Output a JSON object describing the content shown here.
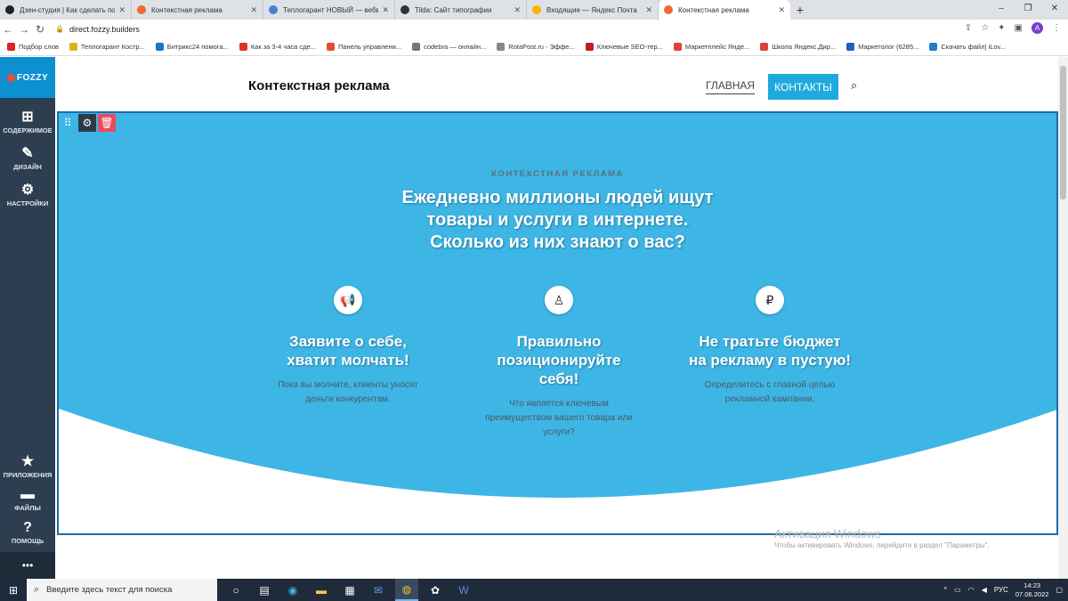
{
  "browser": {
    "tabs": [
      {
        "label": "Дзен-студия | Как сделать посад",
        "color": "#202124"
      },
      {
        "label": "Контекстная реклама",
        "color": "#f06a35"
      },
      {
        "label": "Теплогарант НОВЫЙ — вебвиз",
        "color": "#4a7fd4"
      },
      {
        "label": "Tilda: Сайт типографии",
        "color": "#333333"
      },
      {
        "label": "Входящие — Яндекс Почта",
        "color": "#f7b500"
      },
      {
        "label": "Контекстная реклама",
        "color": "#f06a35",
        "active": true
      }
    ],
    "new_tab": "+",
    "url": "direct.fozzy.builders",
    "profile_letter": "A",
    "bookmarks": [
      {
        "label": "Подбор слов",
        "color": "#d22"
      },
      {
        "label": "Теплогарант Костр...",
        "color": "#e0b020"
      },
      {
        "label": "Битрикс24 помога...",
        "color": "#1e6fd0"
      },
      {
        "label": "Как за 3-4 часа сде...",
        "color": "#e03030"
      },
      {
        "label": "Панель управлени...",
        "color": "#e05030"
      },
      {
        "label": "codebra — онлайн...",
        "color": "#777"
      },
      {
        "label": "RotaPost.ru - Эффе...",
        "color": "#888"
      },
      {
        "label": "Ключевые SEO-тер...",
        "color": "#c02020"
      },
      {
        "label": "Маркетплейс Янде...",
        "color": "#e04040"
      },
      {
        "label": "Школа Яндекс.Дир...",
        "color": "#e04040"
      },
      {
        "label": "Маркетолог (6285...",
        "color": "#2060c0"
      },
      {
        "label": "Скачать файл| iLov...",
        "color": "#2080d0"
      }
    ]
  },
  "sidebar": {
    "logo": "FOZZY",
    "items": [
      {
        "label": "СОДЕРЖИМОЕ",
        "icon": "plus-square-icon",
        "glyph": "⊞"
      },
      {
        "label": "ДИЗАЙН",
        "icon": "brush-icon",
        "glyph": "✎"
      },
      {
        "label": "НАСТРОЙКИ",
        "icon": "gears-icon",
        "glyph": "⚙"
      }
    ],
    "bottom": [
      {
        "label": "ПРИЛОЖЕНИЯ",
        "icon": "star-icon",
        "glyph": "★"
      },
      {
        "label": "ФАЙЛЫ",
        "icon": "folder-icon",
        "glyph": "▬"
      },
      {
        "label": "ПОМОЩЬ",
        "icon": "help-icon",
        "glyph": "?"
      }
    ],
    "more": "•••"
  },
  "site": {
    "title": "Контекстная реклама",
    "nav_home": "ГЛАВНАЯ",
    "nav_contacts": "КОНТАКТЫ",
    "accent": "#1eaadf",
    "block_bg": "#3db6e6"
  },
  "hero": {
    "eyebrow": "КОНТЕКСТНАЯ РЕКЛАМА",
    "headline": [
      "Ежедневно миллионы людей ищут",
      "товары и услуги в интернете.",
      "Сколько из них знают о вас?"
    ],
    "features": [
      {
        "icon": "megaphone-icon",
        "glyph": "📢",
        "title": [
          "Заявите о себе,",
          "хватит молчать!"
        ],
        "desc": [
          "Пока вы молчите, клиенты уносят",
          "деньги конкурентам."
        ]
      },
      {
        "icon": "person-icon",
        "glyph": "♙",
        "title": [
          "Правильно",
          "позиционируйте",
          "себя!"
        ],
        "desc": [
          "Что является ключевым",
          "преимуществом вашего товара или",
          "услуги?"
        ]
      },
      {
        "icon": "ruble-icon",
        "glyph": "₽",
        "title": [
          "Не тратьте бюджет",
          "на рекламу в пустую!"
        ],
        "desc": [
          "Определитесь с главной целью",
          "рекламной кампании."
        ]
      }
    ]
  },
  "watermark": {
    "line1": "Активация Windows",
    "line2": "Чтобы активировать Windows, перейдите в раздел \"Параметры\"."
  },
  "taskbar": {
    "search_placeholder": "Введите здесь текст для поиска",
    "lang": "РУС",
    "time": "14:23",
    "date": "07.06.2022"
  }
}
